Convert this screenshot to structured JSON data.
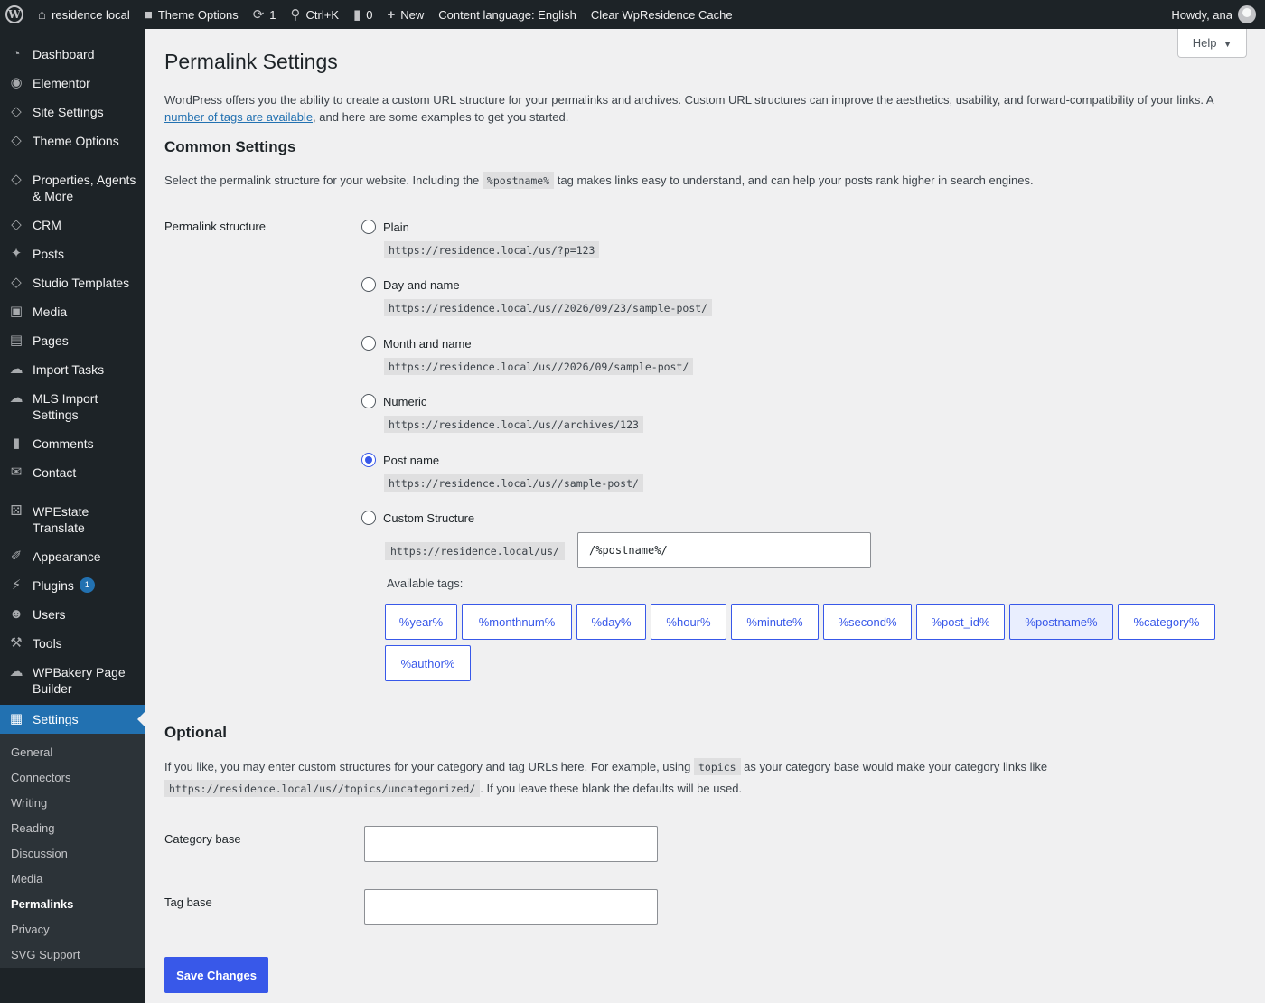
{
  "adminbar": {
    "site_name": "residence local",
    "theme_options": "Theme Options",
    "updates_count": "1",
    "search_shortcut": "Ctrl+K",
    "comments_count": "0",
    "new_label": "New",
    "content_language": "Content language: English",
    "clear_cache": "Clear WpResidence Cache",
    "howdy": "Howdy, ana"
  },
  "sidebar": {
    "items": [
      {
        "label": "Dashboard",
        "icon": "dashboard-icon"
      },
      {
        "label": "Elementor",
        "icon": "elementor-icon"
      },
      {
        "label": "Site Settings",
        "icon": "diamond-icon"
      },
      {
        "label": "Theme Options",
        "icon": "diamond-icon"
      },
      {
        "label": "Properties, Agents & More",
        "icon": "diamond-icon"
      },
      {
        "label": "CRM",
        "icon": "diamond-icon"
      },
      {
        "label": "Posts",
        "icon": "pin-icon"
      },
      {
        "label": "Studio Templates",
        "icon": "diamond-icon"
      },
      {
        "label": "Media",
        "icon": "media-icon"
      },
      {
        "label": "Pages",
        "icon": "pages-icon"
      },
      {
        "label": "Import Tasks",
        "icon": "cloud-icon"
      },
      {
        "label": "MLS Import Settings",
        "icon": "cloud-icon"
      },
      {
        "label": "Comments",
        "icon": "comment-icon"
      },
      {
        "label": "Contact",
        "icon": "mail-icon"
      },
      {
        "label": "WPEstate Translate",
        "icon": "translate-icon"
      },
      {
        "label": "Appearance",
        "icon": "brush-icon"
      },
      {
        "label": "Plugins",
        "icon": "plugin-icon",
        "badge": "1"
      },
      {
        "label": "Users",
        "icon": "user-icon"
      },
      {
        "label": "Tools",
        "icon": "wrench-icon"
      },
      {
        "label": "WPBakery Page Builder",
        "icon": "cloud-icon"
      },
      {
        "label": "Settings",
        "icon": "settings-icon"
      }
    ],
    "submenu": [
      "General",
      "Connectors",
      "Writing",
      "Reading",
      "Discussion",
      "Media",
      "Permalinks",
      "Privacy",
      "SVG Support"
    ]
  },
  "help_label": "Help",
  "page_title": "Permalink Settings",
  "intro_text_1": "WordPress offers you the ability to create a custom URL structure for your permalinks and archives. Custom URL structures can improve the aesthetics, usability, and forward-compatibility of your links. A",
  "intro_link": "number of tags are available",
  "intro_text_2": ", and here are some examples to get you started.",
  "common_heading": "Common Settings",
  "common_text_1": "Select the permalink structure for your website. Including the",
  "common_code": "%postname%",
  "common_text_2": "tag makes links easy to understand, and can help your posts rank higher in search engines.",
  "permalink_label": "Permalink structure",
  "options": [
    {
      "label": "Plain",
      "example": "https://residence.local/us/?p=123",
      "checked": false
    },
    {
      "label": "Day and name",
      "example": "https://residence.local/us//2026/09/23/sample-post/",
      "checked": false
    },
    {
      "label": "Month and name",
      "example": "https://residence.local/us//2026/09/sample-post/",
      "checked": false
    },
    {
      "label": "Numeric",
      "example": "https://residence.local/us//archives/123",
      "checked": false
    },
    {
      "label": "Post name",
      "example": "https://residence.local/us//sample-post/",
      "checked": true
    },
    {
      "label": "Custom Structure",
      "checked": false
    }
  ],
  "custom": {
    "prefix": "https://residence.local/us/",
    "value": "/%postname%/"
  },
  "available_tags_label": "Available tags:",
  "tags": [
    "%year%",
    "%monthnum%",
    "%day%",
    "%hour%",
    "%minute%",
    "%second%",
    "%post_id%",
    "%postname%",
    "%category%",
    "%author%"
  ],
  "active_tag": "%postname%",
  "optional_heading": "Optional",
  "optional_text_1": "If you like, you may enter custom structures for your category and tag URLs here. For example, using",
  "optional_code": "topics",
  "optional_text_2": "as your category base would make your category links like",
  "optional_code_2": "https://residence.local/us//topics/uncategorized/",
  "optional_text_3": ". If you leave these blank the defaults will be used.",
  "category_base_label": "Category base",
  "category_base_value": "",
  "tag_base_label": "Tag base",
  "tag_base_value": "",
  "save_label": "Save Changes",
  "colors": {
    "accent": "#3858e9",
    "admin_bar": "#1d2327",
    "current_menu": "#2271b1"
  }
}
